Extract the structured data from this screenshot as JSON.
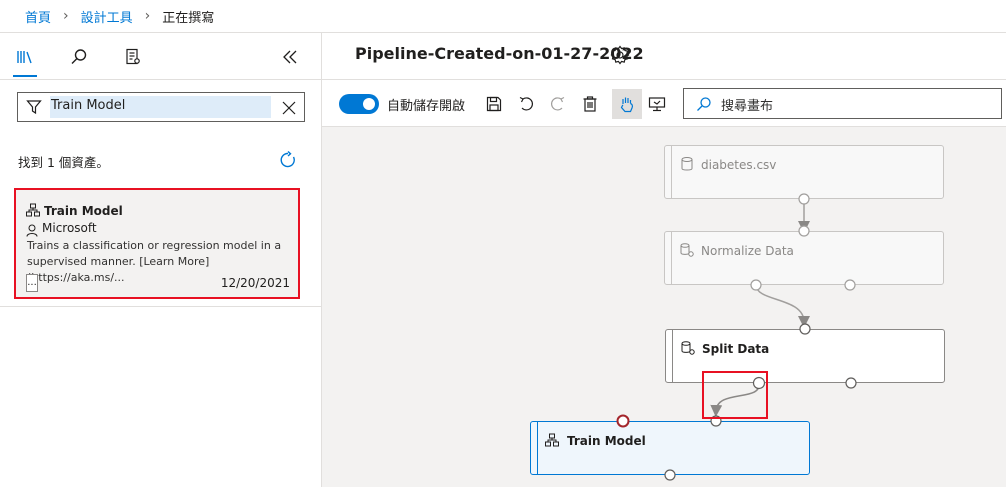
{
  "breadcrumb": {
    "items": [
      "首頁",
      "設計工具",
      "正在撰寫"
    ]
  },
  "left_panel": {
    "tabs": [
      {
        "name": "library",
        "icon": "library-icon",
        "active": true
      },
      {
        "name": "search",
        "icon": "search-icon",
        "active": false
      },
      {
        "name": "assets",
        "icon": "asset-list-icon",
        "active": false
      }
    ],
    "collapse_icon": "double-chevron-left-icon",
    "search": {
      "value": "Train Model",
      "filter_icon": "filter-icon",
      "clear_icon": "close-icon"
    },
    "result_count": "找到 1 個資產。",
    "refresh_icon": "refresh-icon",
    "result": {
      "title": "Train Model",
      "author": "Microsoft",
      "description": "Trains a classification or regression model in a supervised manner. [Learn More](https://aka.ms/...",
      "more_label": "...",
      "date": "12/20/2021"
    }
  },
  "header": {
    "title": "Pipeline-Created-on-01-27-2022",
    "settings_icon": "gear-icon"
  },
  "toolbar": {
    "autosave_label": "自動儲存開啟",
    "autosave_on": true,
    "search_placeholder": "搜尋畫布"
  },
  "canvas": {
    "nodes": [
      {
        "label": "diabetes.csv",
        "icon": "dataset-icon",
        "state": "faded"
      },
      {
        "label": "Normalize Data",
        "icon": "data-transform-icon",
        "state": "faded"
      },
      {
        "label": "Split Data",
        "icon": "data-transform-icon",
        "state": "normal"
      },
      {
        "label": "Train Model",
        "icon": "module-icon",
        "state": "selected"
      }
    ]
  },
  "colors": {
    "accent": "#0078d4",
    "highlight": "#e81123",
    "canvas_bg": "#f3f2f1"
  }
}
